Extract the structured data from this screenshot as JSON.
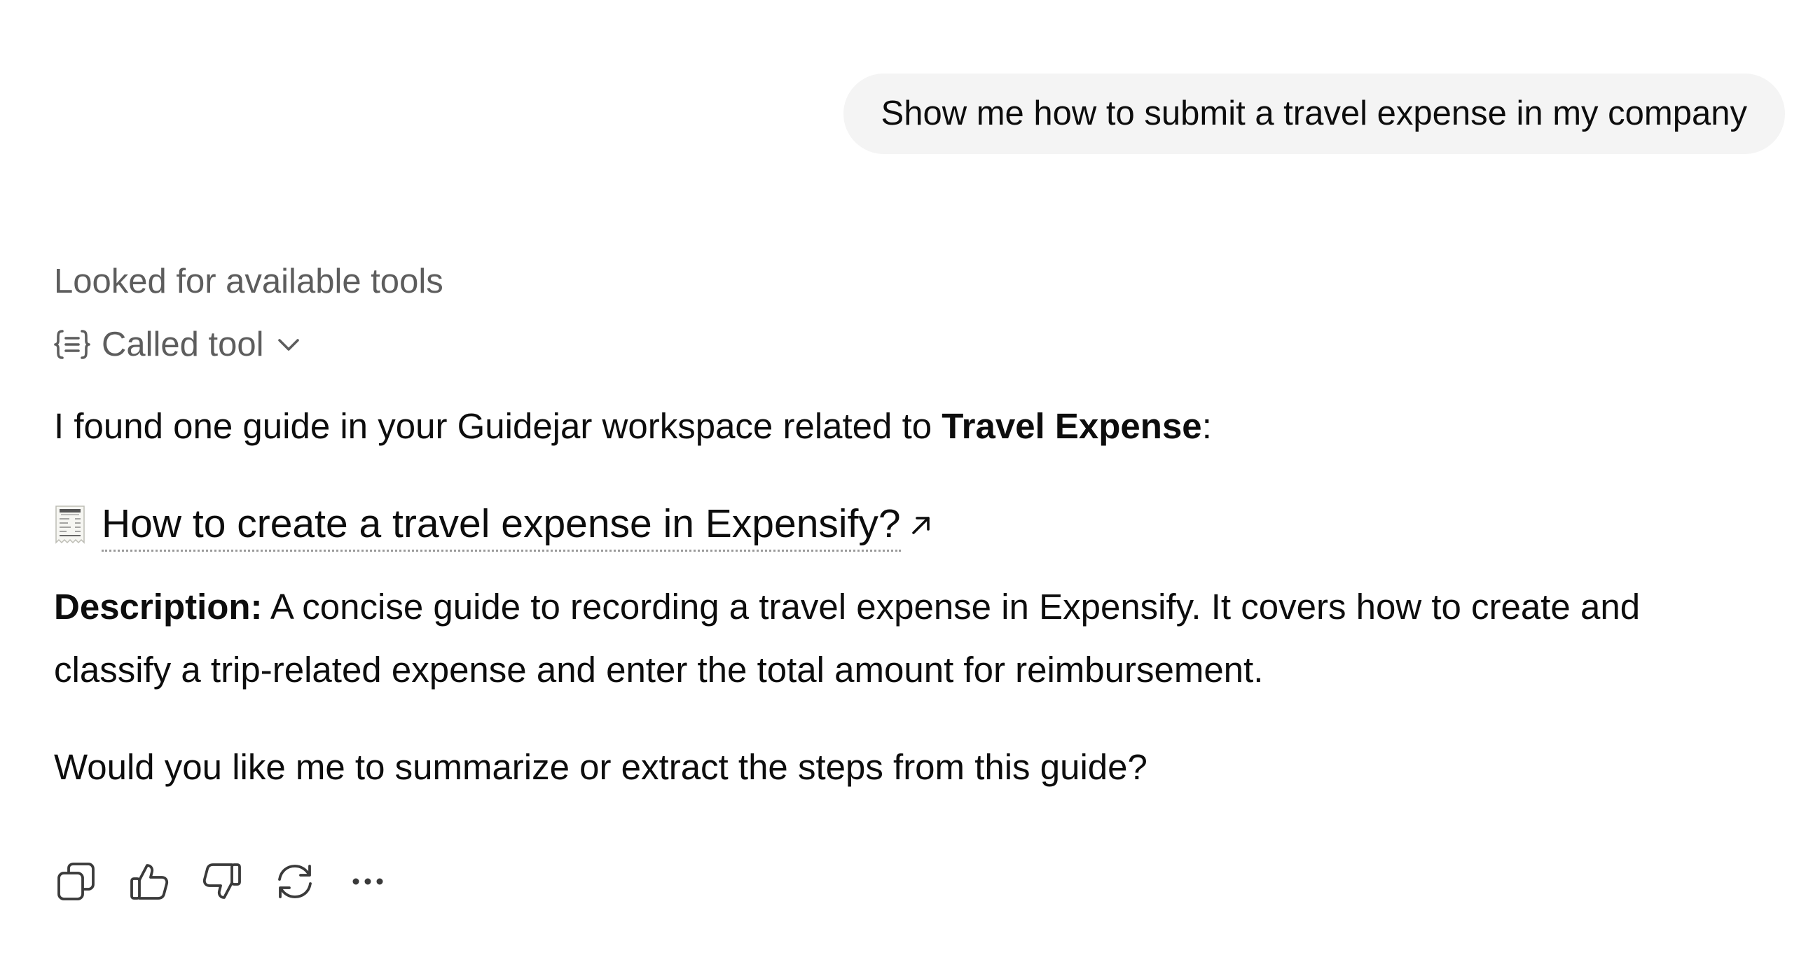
{
  "user_message": "Show me how to submit a travel expense in my company",
  "assistant": {
    "status": "Looked for available tools",
    "tool_call": {
      "label": "Called tool",
      "icon": "braces-list-icon",
      "expand_icon": "chevron-down-icon"
    },
    "intro": {
      "prefix": "I found one guide in your Guidejar workspace related to ",
      "emphasis": "Travel Expense",
      "suffix": ":"
    },
    "guide": {
      "icon": "receipt-icon",
      "title": "How to create a travel expense in Expensify?",
      "link_icon": "external-arrow-icon"
    },
    "description": {
      "label": "Description:",
      "text": " A concise guide to recording a travel expense in Expensify. It covers how to create and classify a trip-related expense and enter the total amount for reimbursement."
    },
    "followup": "Would you like me to summarize or extract the steps from this guide?"
  },
  "actions": [
    {
      "name": "copy-icon"
    },
    {
      "name": "thumbs-up-icon"
    },
    {
      "name": "thumbs-down-icon"
    },
    {
      "name": "regenerate-icon"
    },
    {
      "name": "more-icon"
    }
  ],
  "colors": {
    "bubble_bg": "#f4f4f4",
    "text": "#0d0d0d",
    "muted": "#5d5d5d",
    "icon": "#3a3a3a"
  }
}
